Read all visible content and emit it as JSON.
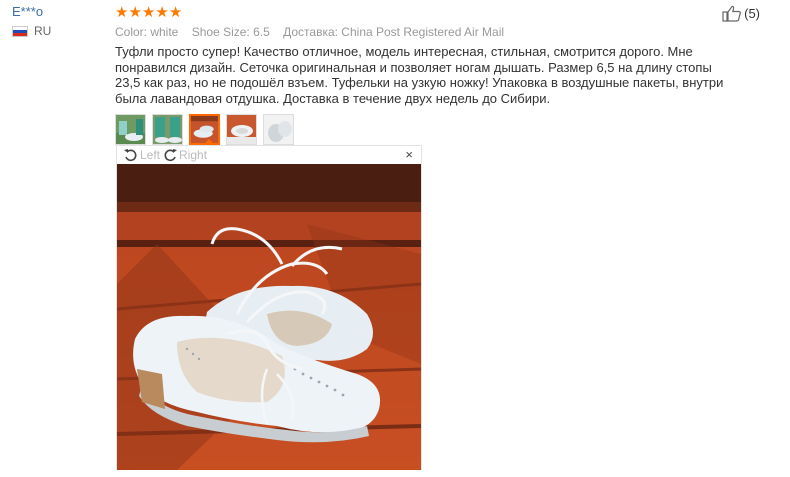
{
  "reviewer": {
    "name": "E***o",
    "country": "RU"
  },
  "rating": {
    "stars": 5,
    "star_glyph": "★",
    "color": "#ff7a00"
  },
  "meta": {
    "color": "Color: white",
    "size": "Shoe Size: 6.5",
    "shipping": "Доставка: China Post Registered Air Mail"
  },
  "review": {
    "text": "Туфли просто супер! Качество отличное, модель интересная, стильная, смотрится дорого. Мне понравился дизайн. Сеточка оригинальная и позволяет ногам дышать. Размер 6,5 на длину стопы 23,5 как раз, но не подошёл взъем. Туфельки на узкую ножку! Упаковка в воздушные пакеты, внутри была лавандовая отдушка. Доставка в течение двух недель до Сибири."
  },
  "likes": {
    "count": "(5)",
    "icon": "thumbs-up-icon"
  },
  "thumbnails": [
    {
      "name": "photo-1",
      "active": false
    },
    {
      "name": "photo-2",
      "active": false
    },
    {
      "name": "photo-3",
      "active": true
    },
    {
      "name": "photo-4",
      "active": false
    },
    {
      "name": "photo-5",
      "active": false
    }
  ],
  "viewer": {
    "rotate_left": "Left",
    "rotate_right": "Right",
    "close": "×"
  },
  "colors": {
    "accent": "#ff6a00",
    "username": "#3a6ea5",
    "meta": "#999999"
  }
}
